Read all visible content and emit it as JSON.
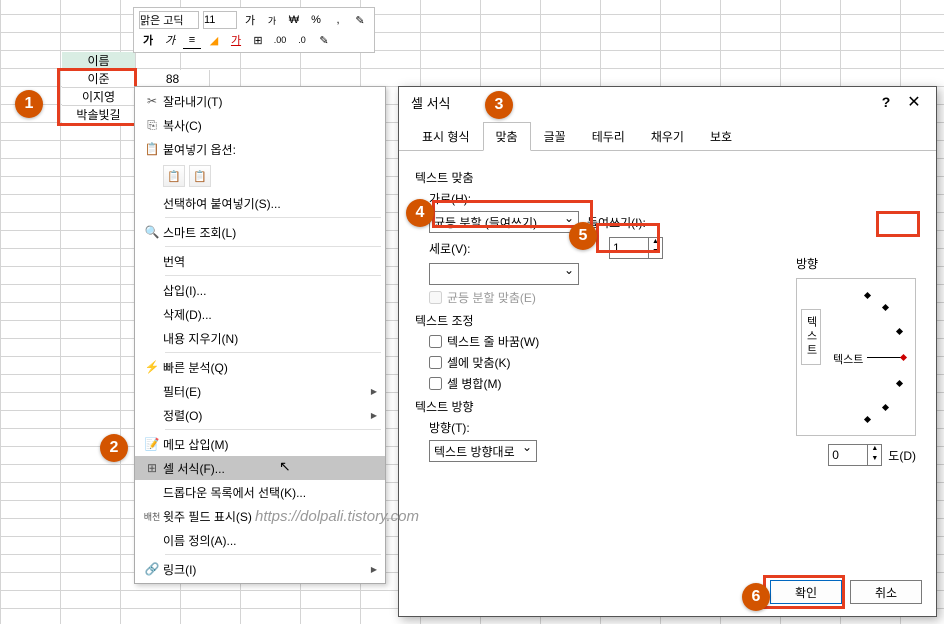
{
  "miniToolbar": {
    "font": "맑은 고딕",
    "size": "11",
    "btns": {
      "incFont": "가",
      "decFont": "가",
      "bold": "가",
      "italic": "가",
      "underline": "가"
    },
    "numFormat": "%",
    "comma": ","
  },
  "cells": {
    "header": "이름",
    "r1": "이준",
    "r2": "이지영",
    "r3": "박솔빛길",
    "v1": "88"
  },
  "contextMenu": {
    "cut": "잘라내기(T)",
    "copy": "복사(C)",
    "pasteOptions": "붙여넣기 옵션:",
    "pasteSpecial": "선택하여 붙여넣기(S)...",
    "smartLookup": "스마트 조회(L)",
    "translate": "번역",
    "insert": "삽입(I)...",
    "delete": "삭제(D)...",
    "clear": "내용 지우기(N)",
    "quickAnalysis": "빠른 분석(Q)",
    "filter": "필터(E)",
    "sort": "정렬(O)",
    "insertComment": "메모 삽입(M)",
    "formatCells": "셀 서식(F)...",
    "pickFromList": "드롭다운 목록에서 선택(K)...",
    "showPhonetic": "윗주 필드 표시(S)",
    "defineName": "이름 정의(A)...",
    "link": "링크(I)"
  },
  "dialog": {
    "title": "셀 서식",
    "tabs": {
      "number": "표시 형식",
      "alignment": "맞춤",
      "font": "글꼴",
      "border": "테두리",
      "fill": "채우기",
      "protection": "보호"
    },
    "textAlign": {
      "section": "텍스트 맞춤",
      "horizLabel": "가로(H):",
      "horizValue": "균등 분할 (들여쓰기)",
      "indentLabel": "들여쓰기(I):",
      "indentValue": "1",
      "vertLabel": "세로(V):",
      "vertValue": "",
      "justifyDist": "균등 분할 맞춤(E)"
    },
    "textControl": {
      "section": "텍스트 조정",
      "wrap": "텍스트 줄 바꿈(W)",
      "shrink": "셀에 맞춤(K)",
      "merge": "셀 병합(M)"
    },
    "rtl": {
      "section": "텍스트 방향",
      "dirLabel": "방향(T):",
      "dirValue": "텍스트 방향대로"
    },
    "orientation": {
      "section": "방향",
      "vertText": "텍스트",
      "horizText": "텍스트",
      "degValue": "0",
      "degLabel": "도(D)"
    },
    "ok": "확인",
    "cancel": "취소"
  },
  "badges": {
    "b1": "1",
    "b2": "2",
    "b3": "3",
    "b4": "4",
    "b5": "5",
    "b6": "6"
  },
  "watermark": "https://dolpali.tistory.com"
}
